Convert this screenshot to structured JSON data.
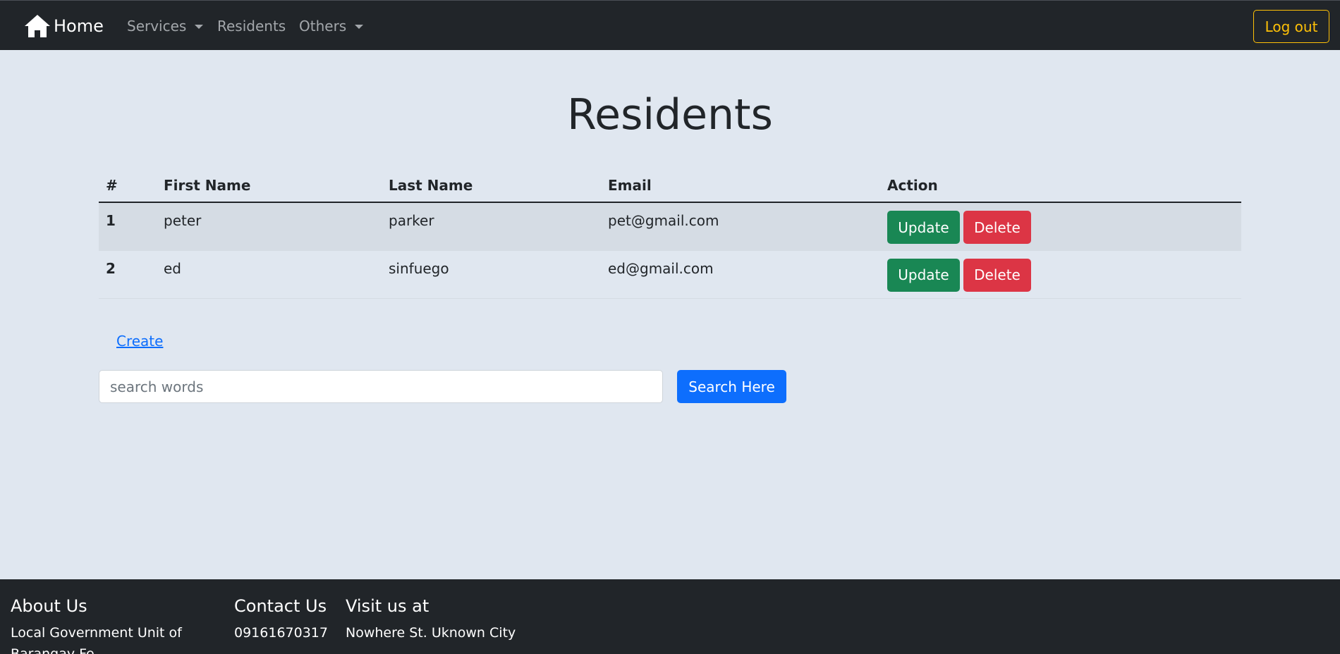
{
  "navbar": {
    "brand_label": "Home",
    "brand_icon": "home-icon",
    "links": {
      "services": "Services",
      "residents": "Residents",
      "others": "Others"
    },
    "logout_label": "Log out",
    "accent_color": "#ffc107"
  },
  "main": {
    "title": "Residents",
    "table": {
      "headers": [
        "#",
        "First Name",
        "Last Name",
        "Email",
        "Action"
      ],
      "rows": [
        {
          "index": "1",
          "first_name": "peter",
          "last_name": "parker",
          "email": "pet@gmail.com"
        },
        {
          "index": "2",
          "first_name": "ed",
          "last_name": "sinfuego",
          "email": "ed@gmail.com"
        }
      ],
      "update_label": "Update",
      "delete_label": "Delete"
    },
    "create_label": "Create",
    "search": {
      "placeholder": "search words",
      "value": "",
      "button_label": "Search Here"
    }
  },
  "footer": {
    "about": {
      "title": "About Us",
      "text": "Local Government Unit of Barangay Fe..."
    },
    "contact": {
      "title": "Contact Us",
      "text": "09161670317"
    },
    "visit": {
      "title": "Visit us at",
      "text": "Nowhere St. Uknown City"
    }
  },
  "colors": {
    "navbar_bg": "#212529",
    "page_bg": "#e0e7f0",
    "success": "#198754",
    "danger": "#dc3545",
    "primary": "#0d6efd"
  }
}
